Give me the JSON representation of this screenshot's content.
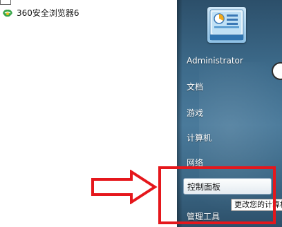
{
  "programs": [
    {
      "label": "360安全浏览器6",
      "icon": "360-browser-icon"
    }
  ],
  "right_menu": {
    "user_tile_icon": "control-panel-user-picture-icon",
    "items": [
      {
        "label": "Administrator"
      },
      {
        "label": "文档"
      },
      {
        "label": "游戏"
      },
      {
        "label": "计算机"
      },
      {
        "label": "网络"
      },
      {
        "label": "控制面板"
      },
      {
        "label": "管理工具"
      }
    ]
  },
  "tooltip": {
    "text": "更改您的计算机"
  },
  "annotation": {
    "arrow_icon": "outlined-right-arrow-icon",
    "color": "#e5171c"
  }
}
